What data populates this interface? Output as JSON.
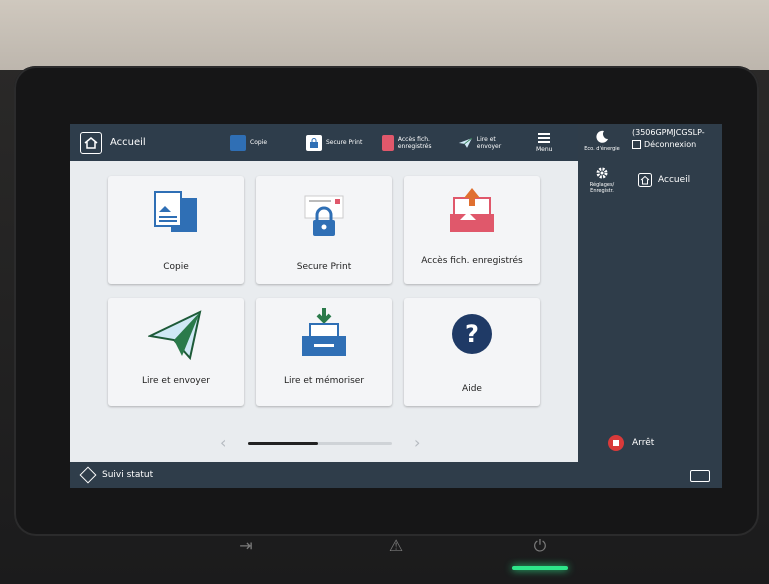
{
  "topbar": {
    "home_label": "Accueil",
    "copy_label": "Copie",
    "secure_label": "Secure Print",
    "files_label": "Accès fich. enregistrés",
    "send_label": "Lire et envoyer",
    "menu_label": "Menu"
  },
  "right_panel": {
    "eco_label": "Eco. d'énergie",
    "user_id": "(3506GPMJCGSLP-",
    "logout_label": "Déconnexion",
    "settings_label": "Réglages/ Enregistr.",
    "home_label": "Accueil",
    "stop_label": "Arrêt"
  },
  "tiles": [
    {
      "label": "Copie"
    },
    {
      "label": "Secure Print"
    },
    {
      "label": "Accès fich. enregistrés"
    },
    {
      "label": "Lire et envoyer"
    },
    {
      "label": "Lire et mémoriser"
    },
    {
      "label": "Aide"
    }
  ],
  "bottombar": {
    "status_label": "Suivi statut"
  },
  "pager": {
    "page": 1,
    "pages": 2
  },
  "colors": {
    "bar": "#2e3d4b",
    "accent_blue": "#2f6fb5",
    "accent_red": "#e0586b",
    "accent_green": "#2a7a4a",
    "stop_red": "#d93a3a"
  }
}
